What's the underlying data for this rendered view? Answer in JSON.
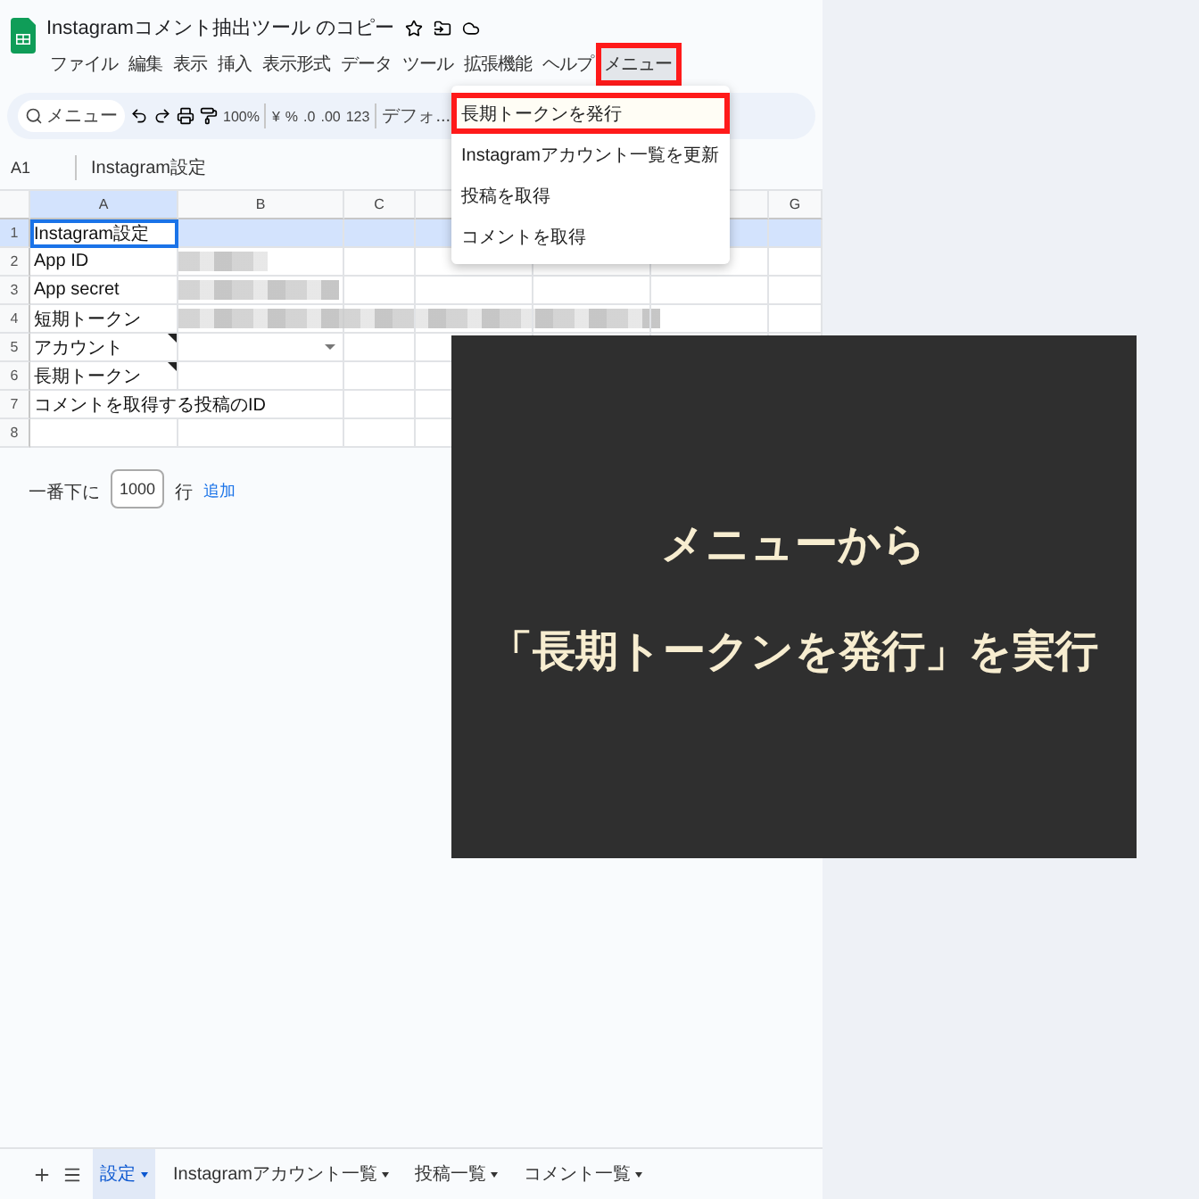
{
  "document": {
    "title": "Instagramコメント抽出ツール のコピー"
  },
  "menubar": [
    {
      "label": "ファイル",
      "selected": false,
      "highlighted": false
    },
    {
      "label": "編集",
      "selected": false,
      "highlighted": false
    },
    {
      "label": "表示",
      "selected": false,
      "highlighted": false
    },
    {
      "label": "挿入",
      "selected": false,
      "highlighted": false
    },
    {
      "label": "表示形式",
      "selected": false,
      "highlighted": false
    },
    {
      "label": "データ",
      "selected": false,
      "highlighted": false
    },
    {
      "label": "ツール",
      "selected": false,
      "highlighted": false
    },
    {
      "label": "拡張機能",
      "selected": false,
      "highlighted": false
    },
    {
      "label": "ヘルプ",
      "selected": false,
      "highlighted": false
    },
    {
      "label": "メニュー",
      "selected": true,
      "highlighted": true
    }
  ],
  "toolbar": {
    "search": "メニュー",
    "zoom": "100%",
    "currency": "¥",
    "percent": "%",
    "decrease_decimal": ".0",
    "increase_decimal": ".00",
    "number_format": "123",
    "font": "デフォ..."
  },
  "dropdown_menu": [
    {
      "label": "長期トークンを発行",
      "highlighted": true
    },
    {
      "label": "Instagramアカウント一覧を更新",
      "highlighted": false
    },
    {
      "label": "投稿を取得",
      "highlighted": false
    },
    {
      "label": "コメントを取得",
      "highlighted": false
    }
  ],
  "formula_bar": {
    "cell": "A1",
    "value": "Instagram設定"
  },
  "columns": [
    {
      "label": "A",
      "selected": true
    },
    {
      "label": "B",
      "selected": false
    },
    {
      "label": "C",
      "selected": false
    },
    {
      "label": "G",
      "selected": false
    }
  ],
  "rows": [
    {
      "number": "1",
      "value": "Instagram設定",
      "selected": true,
      "note": false,
      "dropdown": false,
      "redacted": false
    },
    {
      "number": "2",
      "value": "App ID",
      "selected": false,
      "note": false,
      "dropdown": false,
      "redacted": true
    },
    {
      "number": "3",
      "value": "App secret",
      "selected": false,
      "note": false,
      "dropdown": false,
      "redacted": true
    },
    {
      "number": "4",
      "value": "短期トークン",
      "selected": false,
      "note": false,
      "dropdown": false,
      "redacted": true
    },
    {
      "number": "5",
      "value": "アカウント",
      "selected": false,
      "note": true,
      "dropdown": true,
      "redacted": false
    },
    {
      "number": "6",
      "value": "長期トークン",
      "selected": false,
      "note": true,
      "dropdown": false,
      "redacted": false
    },
    {
      "number": "7",
      "value": "コメントを取得する投稿のID",
      "selected": false,
      "note": false,
      "dropdown": false,
      "redacted": false
    },
    {
      "number": "8",
      "selected": false,
      "note": false,
      "dropdown": false,
      "redacted": false
    }
  ],
  "add_rows": {
    "prefix": "一番下に",
    "count": "1000",
    "suffix": "行",
    "button": "追加"
  },
  "sheet_tabs": [
    {
      "label": "設定",
      "selected": true
    },
    {
      "label": "Instagramアカウント一覧",
      "selected": false
    },
    {
      "label": "投稿一覧",
      "selected": false
    },
    {
      "label": "コメント一覧",
      "selected": false
    }
  ],
  "caption": {
    "lines": [
      "メニューから",
      "「長期トークンを発行」を実行"
    ]
  }
}
